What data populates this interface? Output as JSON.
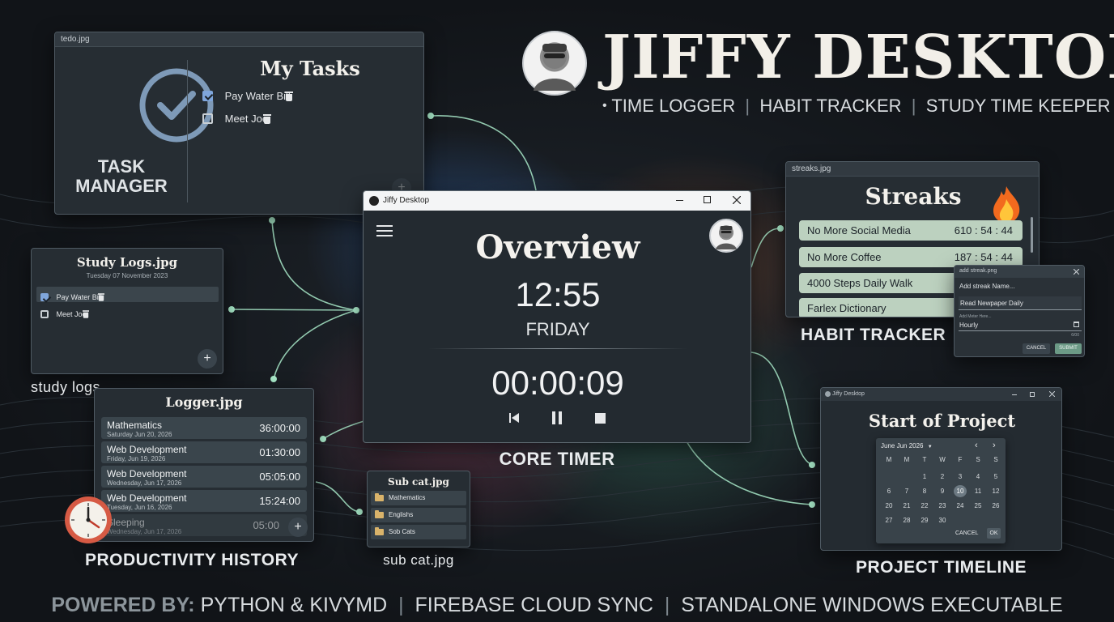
{
  "hero": {
    "title": "JIFFY DESKTOP",
    "subtitle_bullet": "•",
    "subtitle_items": [
      "TIME LOGGER",
      "HABIT TRACKER",
      "STUDY TIME KEEPER"
    ]
  },
  "footer": {
    "label": "POWERED BY:",
    "items": [
      "PYTHON & KIVYMD",
      "FIREBASE CLOUD SYNC",
      "STANDALONE WINDOWS EXECUTABLE"
    ]
  },
  "todo": {
    "file": "tedo.jpg",
    "heading": "My Tasks",
    "brand_line1": "TASK",
    "brand_line2": "MANAGER",
    "tasks": [
      {
        "label": "Pay Water Bill",
        "checked": true
      },
      {
        "label": "Meet Joe",
        "checked": false
      }
    ]
  },
  "study": {
    "heading": "Study Logs.jpg",
    "date": "Tuesday 07 November 2023",
    "tasks": [
      {
        "label": "Pay Water Bill",
        "checked": true
      },
      {
        "label": "Meet Joe",
        "checked": false
      }
    ],
    "fab": "+",
    "caption": "study logs"
  },
  "logger": {
    "heading": "Logger.jpg",
    "rows": [
      {
        "title": "Mathematics",
        "date": "Saturday Jun 20, 2026",
        "value": "36:00:00"
      },
      {
        "title": "Web Development",
        "date": "Friday, Jun 19, 2026",
        "value": "01:30:00"
      },
      {
        "title": "Web Development",
        "date": "Wednesday, Jun 17, 2026",
        "value": "05:05:00"
      },
      {
        "title": "Web Development",
        "date": "Tuesday, Jun 16, 2026",
        "value": "15:24:00"
      },
      {
        "title": "Sleeping",
        "date": "Wednesday, Jun 17, 2026",
        "value": "05:00"
      }
    ],
    "fab": "+",
    "caption": "PRODUCTIVITY HISTORY"
  },
  "main_window": {
    "title": "Jiffy Desktop",
    "heading": "Overview",
    "time": "12:55",
    "day": "FRIDAY",
    "timer": "00:00:09",
    "caption": "CORE TIMER"
  },
  "subcat": {
    "heading": "Sub cat.jpg",
    "items": [
      "Mathematics",
      "Englishs",
      "Sob Cats"
    ],
    "caption": "sub cat.jpg"
  },
  "streaks": {
    "file": "streaks.jpg",
    "heading": "Streaks",
    "items": [
      {
        "name": "No More Social Media",
        "value": "610 : 54 : 44"
      },
      {
        "name": "No More Coffee",
        "value": "187 : 54 : 44"
      },
      {
        "name": "4000 Steps Daily Walk",
        "value": ""
      },
      {
        "name": "Farlex Dictionary",
        "value": ""
      }
    ],
    "caption": "HABIT TRACKER"
  },
  "streak_dialog": {
    "title": "add streak.png",
    "name_label": "Add streak Name...",
    "name_value": "Read Newpaper Daily",
    "meter_label": "Add Meter Here...",
    "meter_value": "Hourly",
    "counter": "6/00",
    "cancel": "CANCEL",
    "submit": "SUBMIT"
  },
  "project": {
    "title": "Jiffy Desktop",
    "heading": "Start of Project",
    "month": "June Jun 2026",
    "weekdays": [
      "M",
      "M",
      "T",
      "W",
      "F",
      "S",
      "S"
    ],
    "weeks": [
      [
        "",
        "",
        "1",
        "2",
        "3",
        "4",
        "5"
      ],
      [
        "6",
        "7",
        "8",
        "9",
        "10",
        "11",
        "12"
      ],
      [
        "20",
        "21",
        "22",
        "23",
        "24",
        "25",
        "26"
      ],
      [
        "27",
        "28",
        "29",
        "30",
        "",
        "",
        ""
      ]
    ],
    "selected": "10",
    "cancel": "CANCEL",
    "ok": "OK",
    "caption": "PROJECT TIMELINE"
  },
  "colors": {
    "accent": "#7fa6dc",
    "streak_bg": "#bcd1bf",
    "connector": "#a8e8c8",
    "panel": "#262d33"
  }
}
